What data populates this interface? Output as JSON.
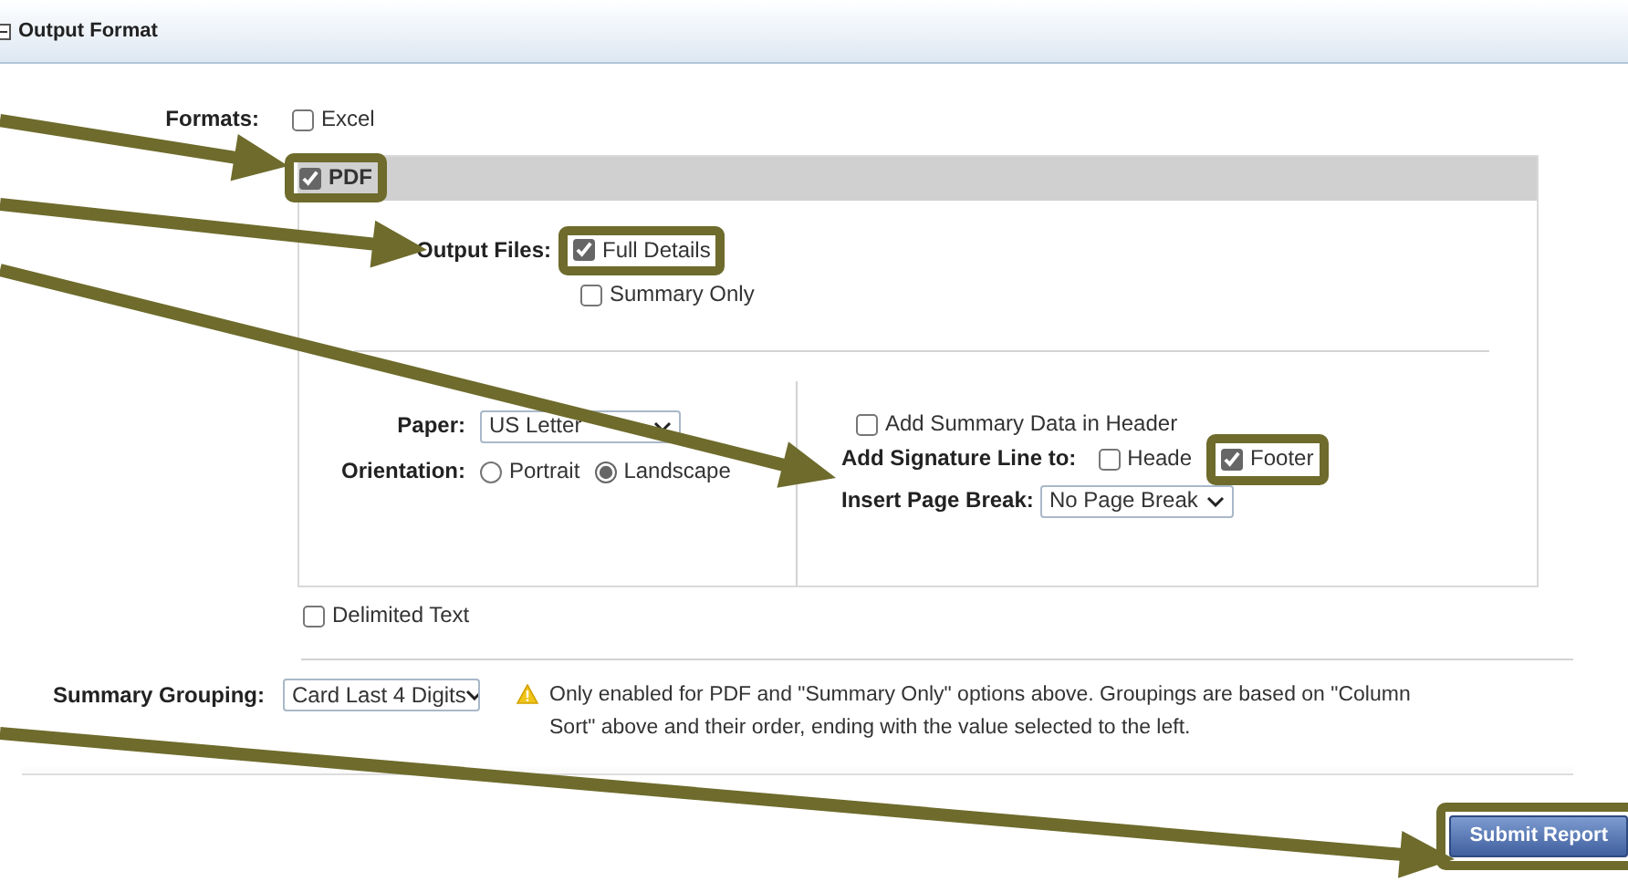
{
  "section": {
    "title": "Output Format",
    "expanded": true
  },
  "formats_label": "Formats:",
  "excel": {
    "label": "Excel",
    "checked": false
  },
  "pdf": {
    "label": "PDF",
    "checked": true,
    "highlighted": true,
    "output_files": {
      "label": "Output Files:",
      "options": [
        {
          "label": "Full Details",
          "checked": true,
          "highlighted": true
        },
        {
          "label": "Summary Only",
          "checked": false,
          "highlighted": false
        }
      ]
    },
    "paper": {
      "label": "Paper:",
      "value": "US Letter"
    },
    "orientation": {
      "label": "Orientation:",
      "options": [
        {
          "label": "Portrait",
          "selected": false
        },
        {
          "label": "Landscape",
          "selected": true
        }
      ]
    },
    "add_summary_data": {
      "label": "Add Summary Data in Header",
      "checked": false
    },
    "signature_line": {
      "label": "Add Signature Line to:",
      "options": [
        {
          "label": "Heade",
          "checked": false,
          "highlighted": false
        },
        {
          "label": "Footer",
          "checked": true,
          "highlighted": true
        }
      ]
    },
    "page_break": {
      "label": "Insert Page Break:",
      "value": "No Page Break"
    }
  },
  "delimited": {
    "label": "Delimited Text",
    "checked": false
  },
  "summary_grouping": {
    "label": "Summary Grouping:",
    "value": "Card Last 4 Digits",
    "note": "Only enabled for PDF and \"Summary Only\" options above. Groupings are based on \"Column Sort\" above and their order, ending with the value selected to the left."
  },
  "submit": {
    "label": "Submit Report",
    "highlighted": true
  }
}
